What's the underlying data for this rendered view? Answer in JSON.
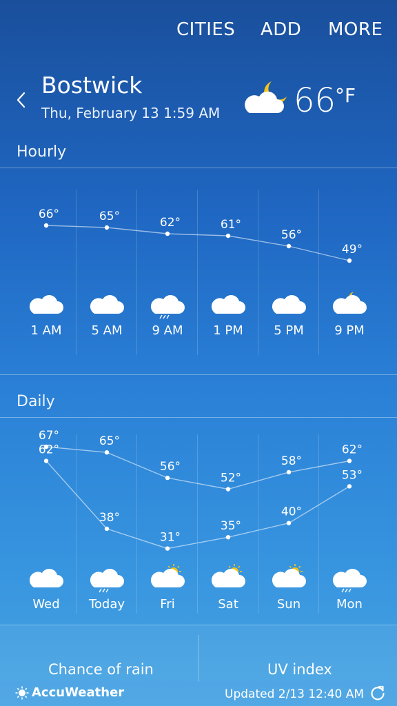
{
  "menu": {
    "cities": "CITIES",
    "add": "ADD",
    "more": "MORE"
  },
  "location": {
    "city": "Bostwick",
    "datetime": "Thu, February 13 1:59 AM"
  },
  "current": {
    "temp": "66",
    "unit": "°F",
    "icon": "cloud-moon-icon"
  },
  "hourly": {
    "title": "Hourly",
    "items": [
      {
        "time": "1 AM",
        "temp": 66,
        "temp_label": "66°",
        "icon": "cloud-icon"
      },
      {
        "time": "5 AM",
        "temp": 65,
        "temp_label": "65°",
        "icon": "cloud-icon"
      },
      {
        "time": "9 AM",
        "temp": 62,
        "temp_label": "62°",
        "icon": "cloud-rain-icon"
      },
      {
        "time": "1 PM",
        "temp": 61,
        "temp_label": "61°",
        "icon": "cloud-icon"
      },
      {
        "time": "5 PM",
        "temp": 56,
        "temp_label": "56°",
        "icon": "cloud-icon"
      },
      {
        "time": "9 PM",
        "temp": 49,
        "temp_label": "49°",
        "icon": "cloud-moon-icon"
      }
    ]
  },
  "daily": {
    "title": "Daily",
    "items": [
      {
        "day": "Wed",
        "high": 67,
        "high_label": "67°",
        "low": 62,
        "low_label": "62°",
        "icon": "cloud-icon"
      },
      {
        "day": "Today",
        "high": 65,
        "high_label": "65°",
        "low": 38,
        "low_label": "38°",
        "icon": "cloud-rain-icon"
      },
      {
        "day": "Fri",
        "high": 56,
        "high_label": "56°",
        "low": 31,
        "low_label": "31°",
        "icon": "cloud-sun-icon"
      },
      {
        "day": "Sat",
        "high": 52,
        "high_label": "52°",
        "low": 35,
        "low_label": "35°",
        "icon": "cloud-sun-icon"
      },
      {
        "day": "Sun",
        "high": 58,
        "high_label": "58°",
        "low": 40,
        "low_label": "40°",
        "icon": "cloud-sun-icon"
      },
      {
        "day": "Mon",
        "high": 62,
        "high_label": "62°",
        "low": 53,
        "low_label": "53°",
        "icon": "cloud-rain-icon"
      }
    ]
  },
  "panels": {
    "rain": "Chance of rain",
    "uv": "UV index"
  },
  "footer": {
    "brand": "AccuWeather",
    "updated": "Updated 2/13   12:40 AM"
  },
  "colors": {
    "moon": "#f5c518",
    "sun": "#f5c518",
    "cloud": "#ffffff"
  }
}
